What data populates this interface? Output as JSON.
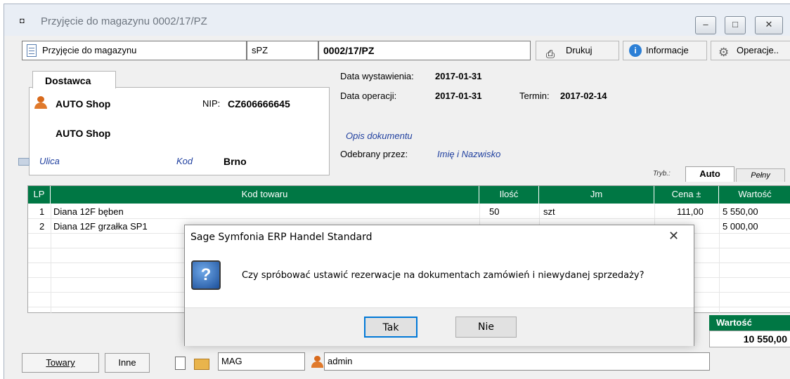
{
  "window": {
    "title": "Przyjęcie do magazynu 0002/17/PZ",
    "title_icon": "◘",
    "minimize": "–",
    "maximize": "□",
    "close": "✕"
  },
  "toolbar": {
    "doc_type": "Przyjęcie do magazynu",
    "symbol": "sPZ",
    "number": "0002/17/PZ",
    "print_label": "Drukuj",
    "info_label": "Informacje",
    "operations_label": "Operacje.."
  },
  "supplier": {
    "tab_label": "Dostawca",
    "name": "AUTO Shop",
    "nip_label": "NIP:",
    "nip_value": "CZ606666645",
    "name2": "AUTO Shop",
    "street_placeholder": "Ulica",
    "postcode_placeholder": "Kod",
    "city": "Brno"
  },
  "document": {
    "issue_date_label": "Data wystawienia:",
    "issue_date": "2017-01-31",
    "operation_date_label": "Data operacji:",
    "operation_date": "2017-01-31",
    "due_label": "Termin:",
    "due_date": "2017-02-14",
    "description_placeholder": "Opis dokumentu",
    "received_by_label": "Odebrany przez:",
    "received_by_placeholder": "Imię i Nazwisko"
  },
  "mode": {
    "label": "Tryb.:",
    "tab_auto": "Auto",
    "tab_full": "Pełny"
  },
  "table": {
    "columns": [
      "LP",
      "Kod towaru",
      "Ilość",
      "Jm",
      "Cena ±",
      "Wartość"
    ],
    "rows": [
      {
        "lp": "1",
        "code": "Diana 12F bęben",
        "qty": "50",
        "unit": "szt",
        "price": "111,00",
        "value": "5 550,00"
      },
      {
        "lp": "2",
        "code": "Diana 12F grzałka SP1",
        "qty": "",
        "unit": "",
        "price": "",
        "value": "5 000,00"
      }
    ]
  },
  "summary": {
    "value_label": "Wartość",
    "total": "10 550,00"
  },
  "bottom": {
    "tab_goods": "Towary",
    "tab_other": "Inne",
    "warehouse": "MAG",
    "user": "admin"
  },
  "dialog": {
    "title": "Sage Symfonia ERP Handel Standard",
    "close": "✕",
    "icon_glyph": "?",
    "message": "Czy spróbować ustawić rezerwacje na dokumentach zamówień i niewydanej sprzedaży?",
    "yes_label": "Tak",
    "no_label": "Nie"
  },
  "colors": {
    "grid_header": "#007744",
    "accent_blue": "#1f3f9f"
  }
}
